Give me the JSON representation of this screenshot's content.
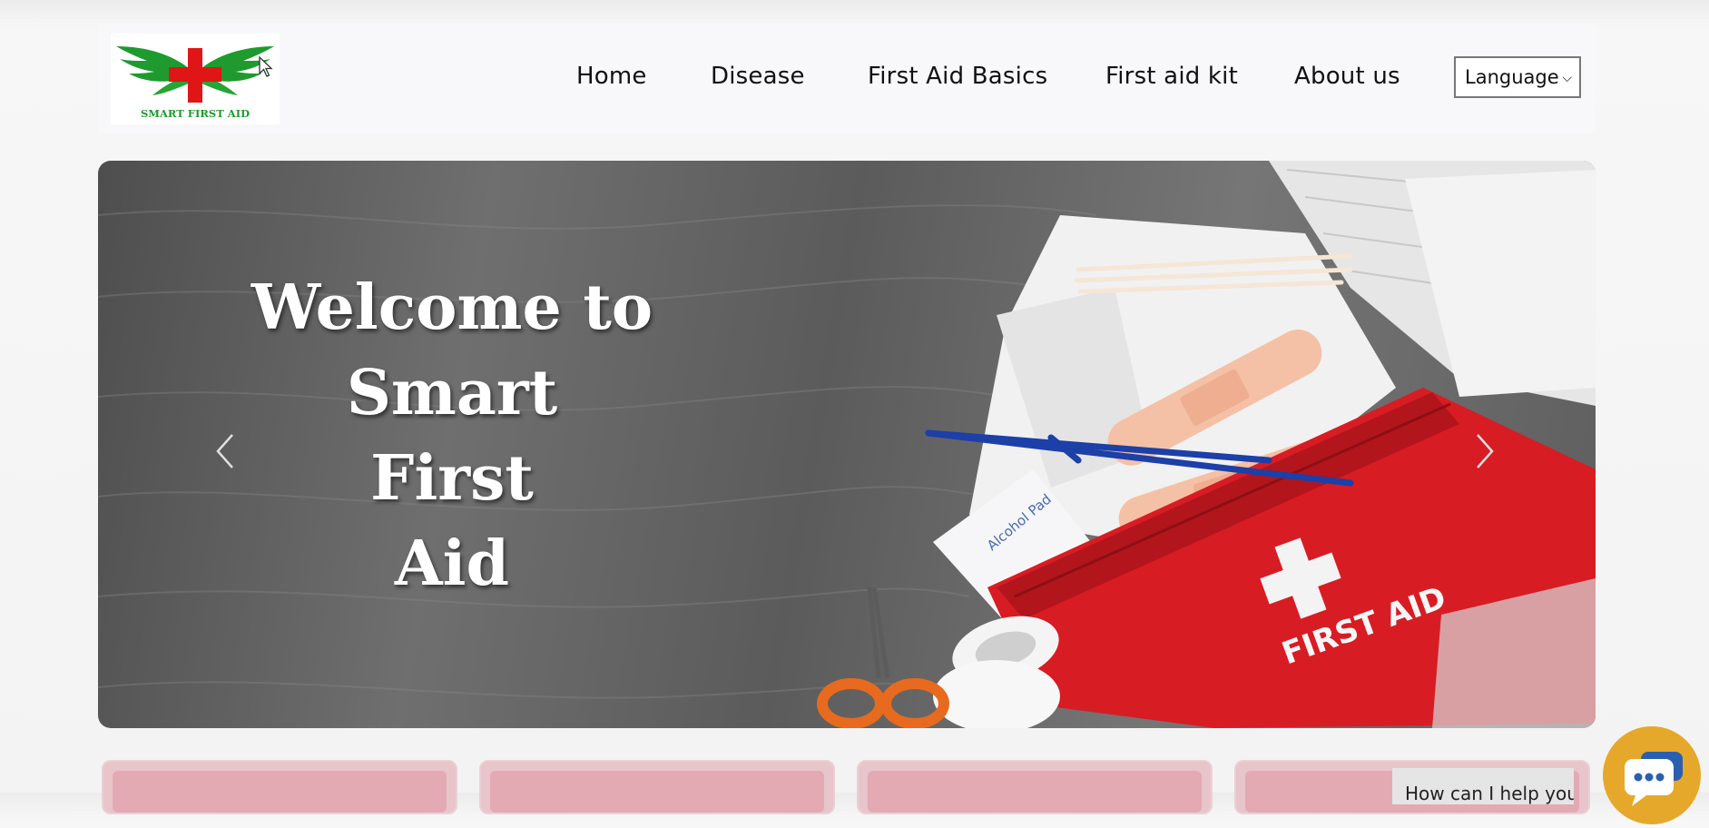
{
  "logo": {
    "text": "SMART FIRST AID"
  },
  "nav": {
    "home": "Home",
    "disease": "Disease",
    "first_aid_basics": "First Aid Basics",
    "first_aid_kit": "First aid kit",
    "about_us": "About us",
    "language_select": "Language"
  },
  "hero": {
    "title_lines": [
      "Welcome to",
      "Smart",
      "First",
      "Aid"
    ],
    "kit_label": "FIRST AID",
    "pad_label": "Alcohol Pad"
  },
  "chat": {
    "prompt": "How can I help you?"
  },
  "colors": {
    "navbar_bg": "#f8f8fa",
    "logo_green": "#1e9a2e",
    "logo_red": "#e01515",
    "card_pink": "#e3aab4",
    "chat_button": "#e6a82a"
  },
  "icons": {
    "logo": "winged-red-cross",
    "prev": "chevron-left-icon",
    "next": "chevron-right-icon",
    "chat": "chat-icon"
  }
}
